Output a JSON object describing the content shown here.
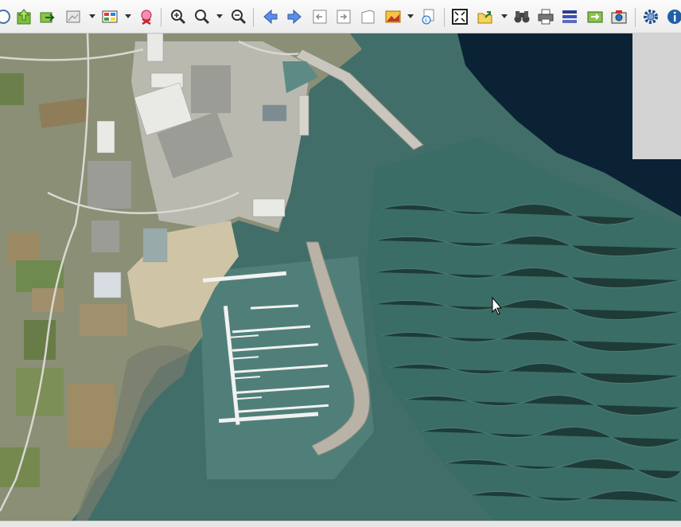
{
  "app": {
    "type": "map-viewer",
    "view": "aerial-imagery"
  },
  "toolbar": {
    "buttons": [
      {
        "name": "identify-button",
        "icon": "circle-info-icon"
      },
      {
        "name": "home-button",
        "icon": "home-arrow-icon"
      },
      {
        "name": "export-button",
        "icon": "export-arrow-icon"
      },
      {
        "name": "layer-image-button",
        "icon": "image-layer-icon",
        "dropdown": true
      },
      {
        "name": "legend-button",
        "icon": "legend-grid-icon",
        "dropdown": true
      },
      {
        "name": "clear-button",
        "icon": "clear-icon"
      },
      {
        "name": "zoom-in-button",
        "icon": "zoom-in-icon"
      },
      {
        "name": "zoom-box-button",
        "icon": "zoom-box-icon",
        "dropdown": true
      },
      {
        "name": "zoom-out-button",
        "icon": "zoom-out-icon"
      },
      {
        "name": "back-button",
        "icon": "arrow-left-icon"
      },
      {
        "name": "forward-button",
        "icon": "arrow-right-icon"
      },
      {
        "name": "prev-extent-button",
        "icon": "prev-extent-icon"
      },
      {
        "name": "next-extent-button",
        "icon": "next-extent-icon"
      },
      {
        "name": "page-button",
        "icon": "page-icon"
      },
      {
        "name": "image-tools-button",
        "icon": "picture-icon",
        "dropdown": true
      },
      {
        "name": "info-tool-button",
        "icon": "info-pointer-icon"
      },
      {
        "name": "full-extent-button",
        "icon": "full-extent-icon"
      },
      {
        "name": "open-folder-button",
        "icon": "folder-open-icon",
        "dropdown": true
      },
      {
        "name": "find-button",
        "icon": "binoculars-icon"
      },
      {
        "name": "print-button",
        "icon": "printer-icon"
      },
      {
        "name": "layers-button",
        "icon": "layers-icon"
      },
      {
        "name": "export-image-button",
        "icon": "export-image-icon"
      },
      {
        "name": "screenshot-button",
        "icon": "camera-icon"
      },
      {
        "name": "settings-button",
        "icon": "gear-icon"
      },
      {
        "name": "help-button",
        "icon": "info-icon"
      }
    ]
  },
  "colors": {
    "sea": "#3e6f6a",
    "deep_water": "#0b2235",
    "land": "#8a8f76",
    "urban": "#b7b7ad",
    "panel": "#d3d3d3"
  }
}
